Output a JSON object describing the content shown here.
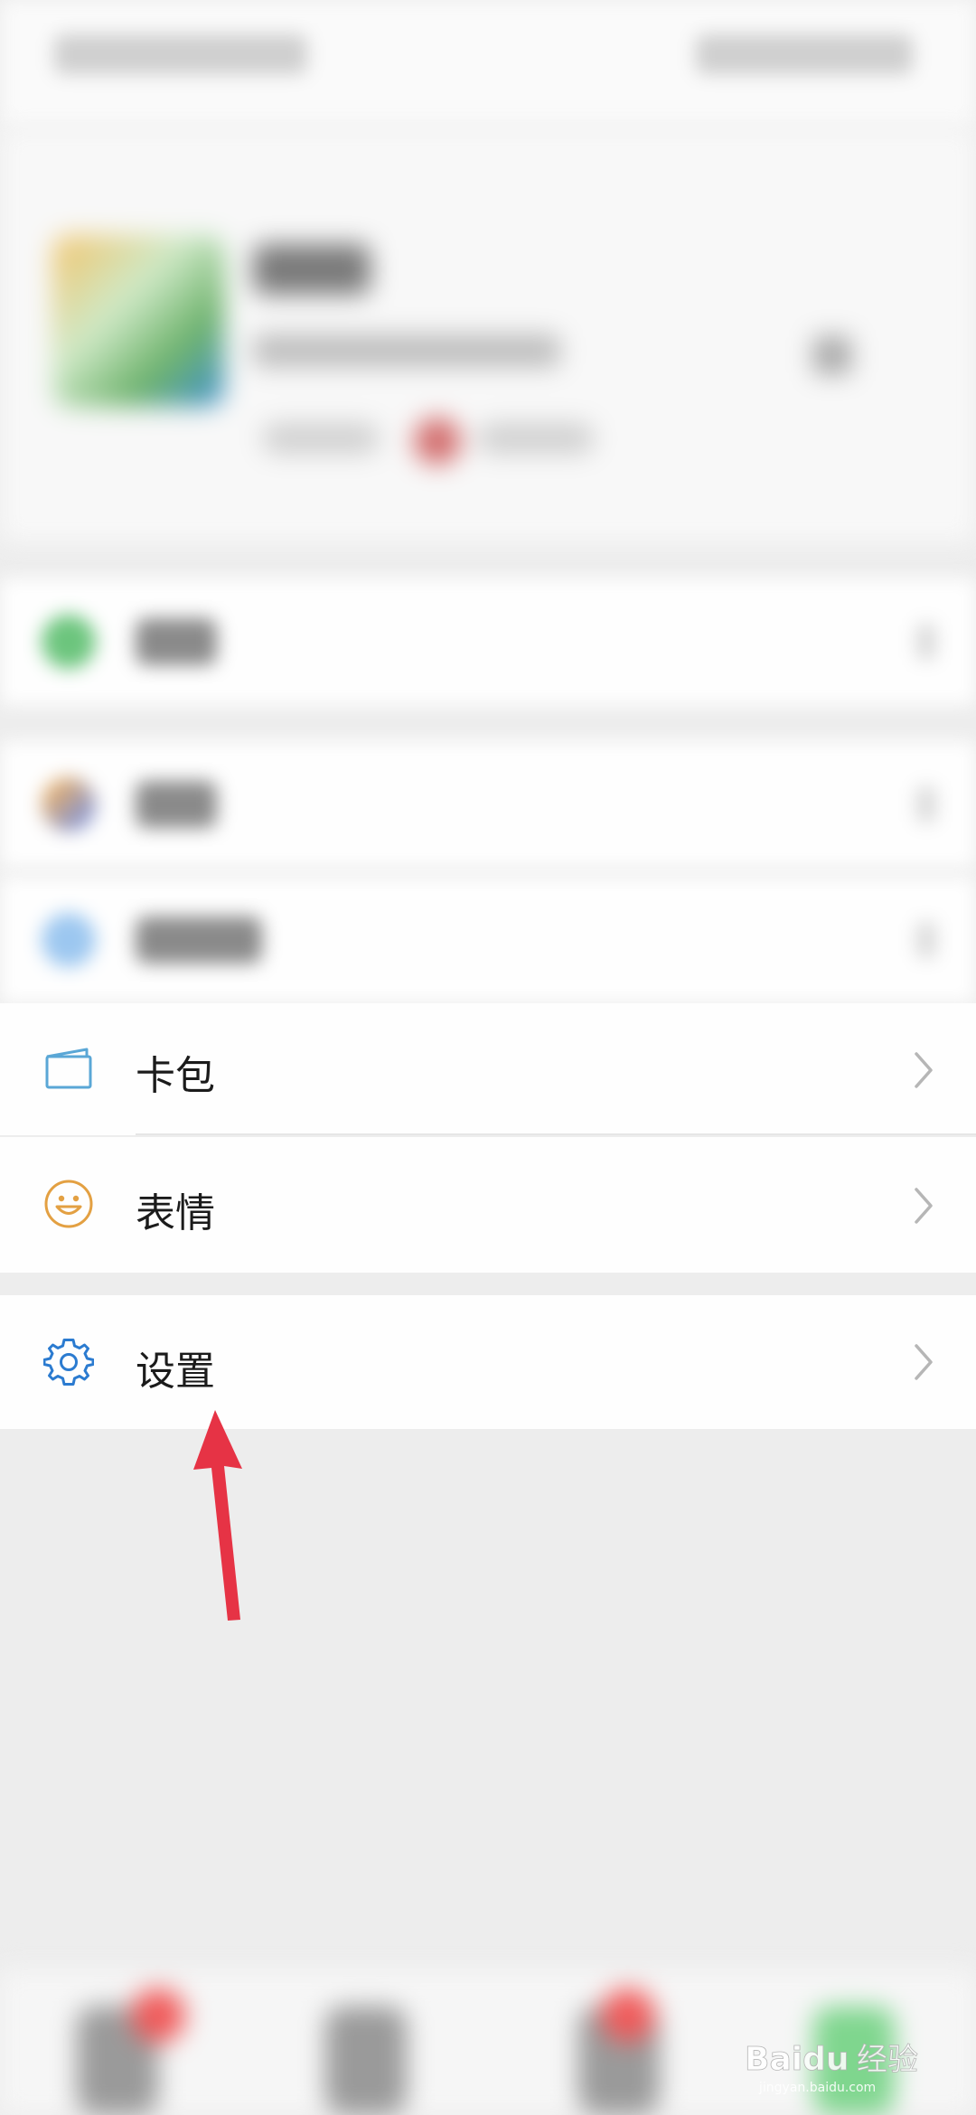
{
  "menu": {
    "card_label": "卡包",
    "sticker_label": "表情",
    "settings_label": "设置"
  },
  "colors": {
    "card_icon": "#5aa7d6",
    "sticker_icon": "#e3a042",
    "settings_icon": "#2b7bd0",
    "arrow": "#e63345",
    "chevron": "#b6b6b6"
  },
  "icons": {
    "card": "card-wallet-icon",
    "sticker": "smiley-icon",
    "settings": "gear-icon",
    "chevron": "chevron-right-icon"
  },
  "watermark": {
    "brand": "Baidu",
    "text": "经验",
    "url": "jingyan.baidu.com"
  }
}
